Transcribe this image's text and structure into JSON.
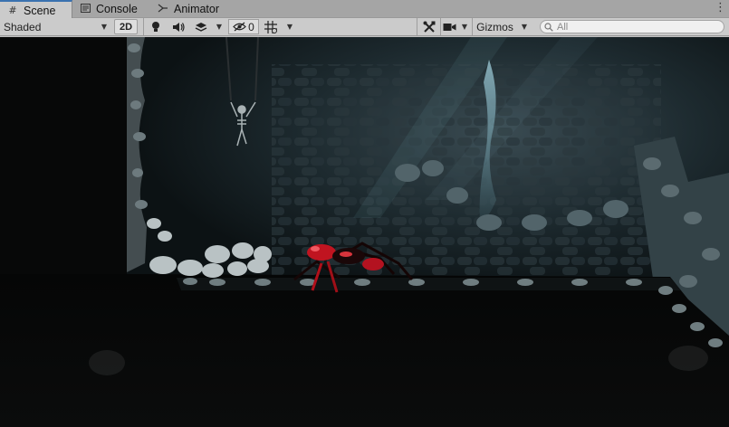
{
  "tabs": [
    {
      "label": "Scene",
      "icon": "grid-icon",
      "active": true
    },
    {
      "label": "Console",
      "icon": "console-icon",
      "active": false
    },
    {
      "label": "Animator",
      "icon": "animator-icon",
      "active": false
    }
  ],
  "toolbar": {
    "shading_mode": "Shaded",
    "mode_2d": "2D",
    "hidden_count": "0",
    "gizmos_label": "Gizmos",
    "search_placeholder": "All"
  },
  "colors": {
    "tab_active_accent": "#3a72b0",
    "toolbar_bg": "#cbcbcb",
    "scene_bg": "#070808"
  }
}
